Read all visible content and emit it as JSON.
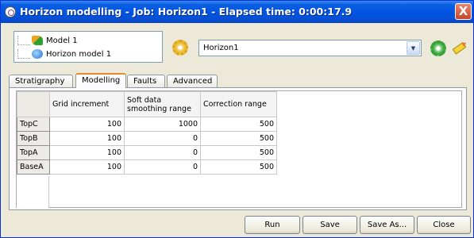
{
  "window": {
    "title": "Horizon modelling - Job: Horizon1 - Elapsed time: 0:00:17.9",
    "close_glyph": "X"
  },
  "tree": {
    "items": [
      {
        "label": "Model 1",
        "icon": "model-icon"
      },
      {
        "label": "Horizon model 1",
        "icon": "horizon-model-icon"
      }
    ]
  },
  "job": {
    "selected": "Horizon1",
    "arrow": "▼"
  },
  "tabs": [
    {
      "label": "Stratigraphy",
      "active": false
    },
    {
      "label": "Modelling",
      "active": true
    },
    {
      "label": "Faults",
      "active": false
    },
    {
      "label": "Advanced",
      "active": false
    }
  ],
  "grid": {
    "columns": [
      "Grid increment",
      "Soft data smoothing range",
      "Correction range"
    ],
    "rows": [
      {
        "name": "TopC",
        "values": [
          "100",
          "1000",
          "500"
        ]
      },
      {
        "name": "TopB",
        "values": [
          "100",
          "0",
          "500"
        ]
      },
      {
        "name": "TopA",
        "values": [
          "100",
          "0",
          "500"
        ]
      },
      {
        "name": "BaseA",
        "values": [
          "100",
          "0",
          "500"
        ]
      }
    ]
  },
  "buttons": {
    "run": "Run",
    "save": "Save",
    "save_as": "Save As...",
    "close": "Close"
  }
}
